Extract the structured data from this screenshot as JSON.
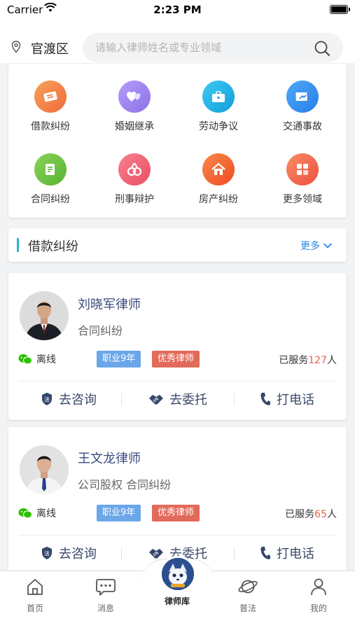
{
  "status_bar": {
    "carrier": "Carrier",
    "time": "2:23 PM"
  },
  "header": {
    "district": "官渡区",
    "search_placeholder": "请输入律师姓名或专业领域"
  },
  "categories": [
    {
      "label": "借款纠纷",
      "icon": "loan-ticket-icon",
      "color": "#f27a43"
    },
    {
      "label": "婚姻继承",
      "icon": "marriage-hearts-icon",
      "color": "#9b7ff0"
    },
    {
      "label": "劳动争议",
      "icon": "briefcase-icon",
      "color": "#1fb5e8"
    },
    {
      "label": "交通事故",
      "icon": "car-accident-icon",
      "color": "#2f8fef"
    },
    {
      "label": "合同纠纷",
      "icon": "contract-icon",
      "color": "#69c142"
    },
    {
      "label": "刑事辩护",
      "icon": "handcuffs-icon",
      "color": "#f0596b"
    },
    {
      "label": "房产纠纷",
      "icon": "house-icon",
      "color": "#f25c2e"
    },
    {
      "label": "更多领域",
      "icon": "grid-more-icon",
      "color": "#f1654a"
    }
  ],
  "section": {
    "title": "借款纠纷",
    "more": "更多"
  },
  "lawyers": [
    {
      "name": "刘晓军律师",
      "specialty": "合同纠纷",
      "status": "离线",
      "tag_years": "职业9年",
      "tag_award": "优秀律师",
      "served_prefix": "已服务",
      "served_count": "127",
      "served_suffix": "人"
    },
    {
      "name": "王文龙律师",
      "specialty": "公司股权 合同纠纷",
      "status": "离线",
      "tag_years": "职业9年",
      "tag_award": "优秀律师",
      "served_prefix": "已服务",
      "served_count": "65",
      "served_suffix": "人"
    }
  ],
  "actions": {
    "consult": "去咨询",
    "entrust": "去委托",
    "call": "打电话"
  },
  "tabs": [
    {
      "label": "首页",
      "icon": "home-icon"
    },
    {
      "label": "消息",
      "icon": "message-icon"
    },
    {
      "label": "律师库",
      "icon": "lawyer-library-icon"
    },
    {
      "label": "普法",
      "icon": "planet-icon"
    },
    {
      "label": "我的",
      "icon": "profile-icon"
    }
  ],
  "active_tab": "律师库"
}
